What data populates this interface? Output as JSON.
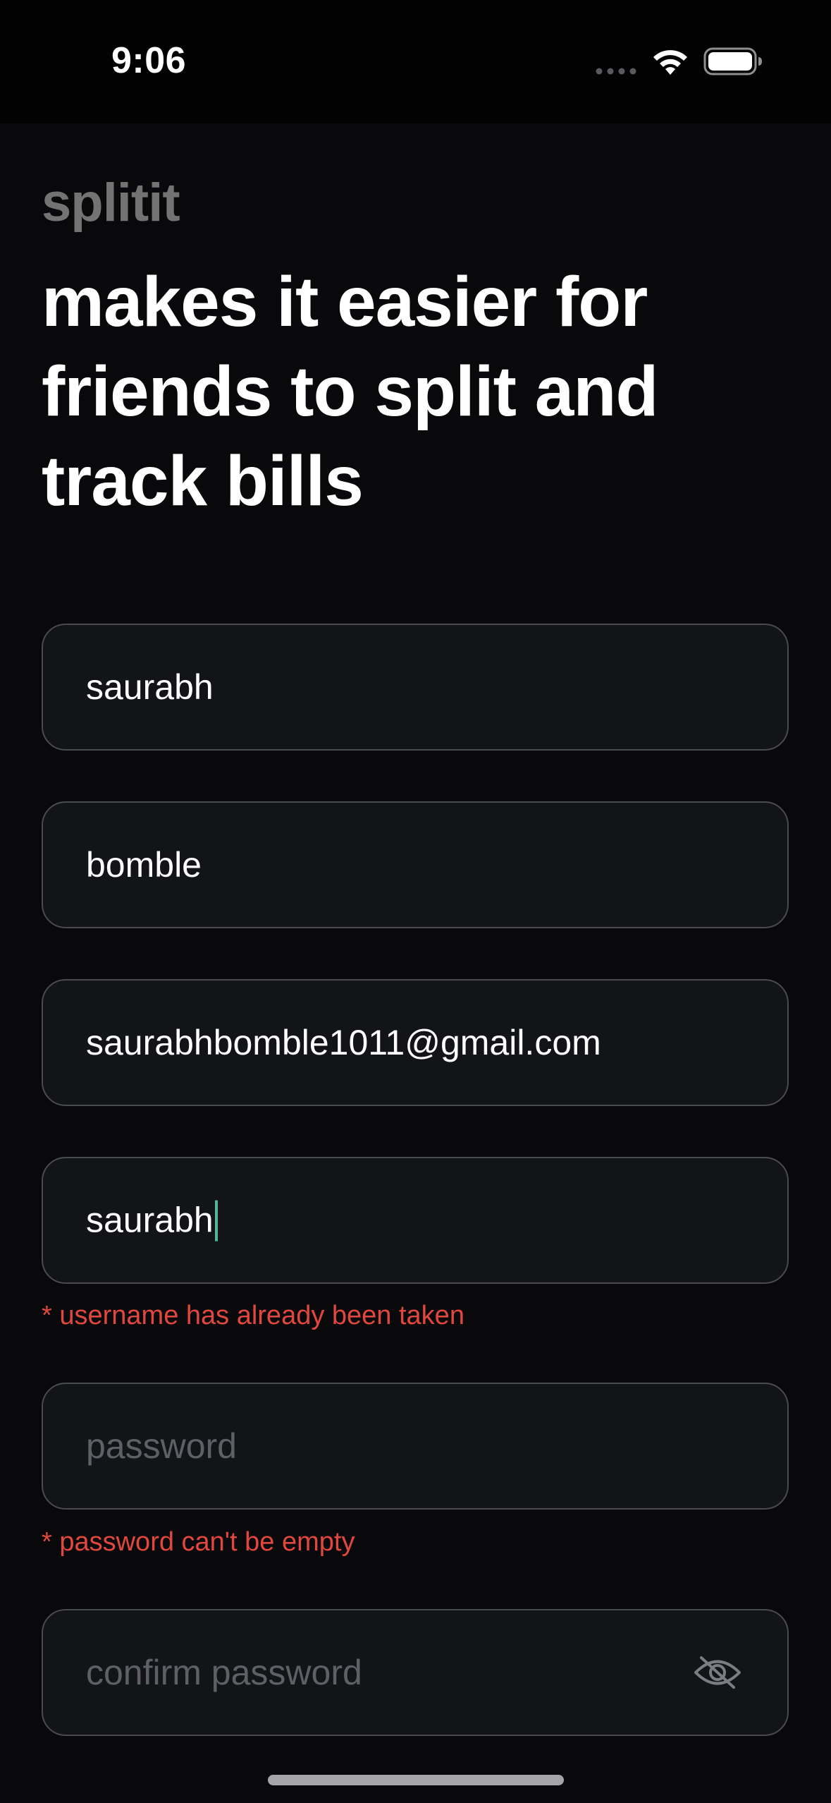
{
  "status_bar": {
    "time": "9:06"
  },
  "app": {
    "brand": "splitit",
    "headline": "makes it easier for friends to split and track bills"
  },
  "form": {
    "first_name": {
      "value": "saurabh",
      "placeholder": ""
    },
    "last_name": {
      "value": "bomble",
      "placeholder": ""
    },
    "email": {
      "value": "saurabhbomble1011@gmail.com",
      "placeholder": ""
    },
    "username": {
      "value": "saurabh",
      "error": "* username has already been taken"
    },
    "password": {
      "value": "",
      "placeholder": "password",
      "error": "* password can't be empty"
    },
    "confirm_password": {
      "value": "",
      "placeholder": "confirm password"
    }
  },
  "icons": {
    "wifi": "wifi-icon",
    "battery": "battery-icon",
    "cellular": "cellular-signal-icon",
    "visibility": "eye-off-icon"
  },
  "colors": {
    "background": "#09090b",
    "status_bar_background": "#020203",
    "field_background": "#131418",
    "field_border": "#4a4b50",
    "brand_text": "#737373",
    "error_text": "#e0473f",
    "caret": "#4db89a"
  }
}
